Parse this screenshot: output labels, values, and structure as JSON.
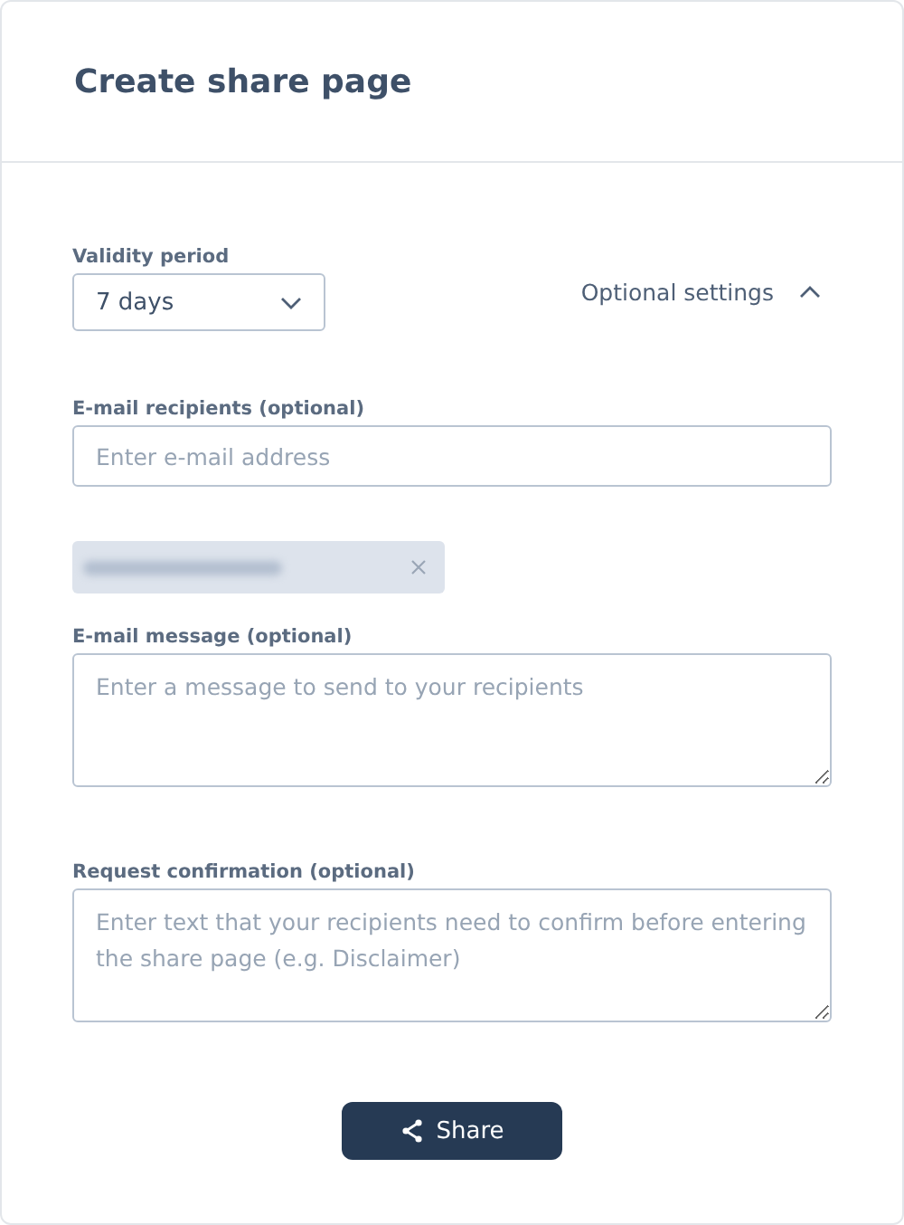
{
  "title": "Create share page",
  "validity": {
    "label": "Validity period",
    "value": "7 days"
  },
  "optional_settings": {
    "label": "Optional settings",
    "expanded": true
  },
  "recipients": {
    "label": "E-mail recipients (optional)",
    "placeholder": "Enter e-mail address",
    "chips": [
      {
        "redacted": true
      }
    ]
  },
  "message": {
    "label": "E-mail message (optional)",
    "placeholder": "Enter a message to send to your recipients"
  },
  "confirmation": {
    "label": "Request confirmation (optional)",
    "placeholder": "Enter text that your recipients need to confirm before entering the share page (e.g. Disclaimer)"
  },
  "share_button": {
    "label": "Share"
  }
}
